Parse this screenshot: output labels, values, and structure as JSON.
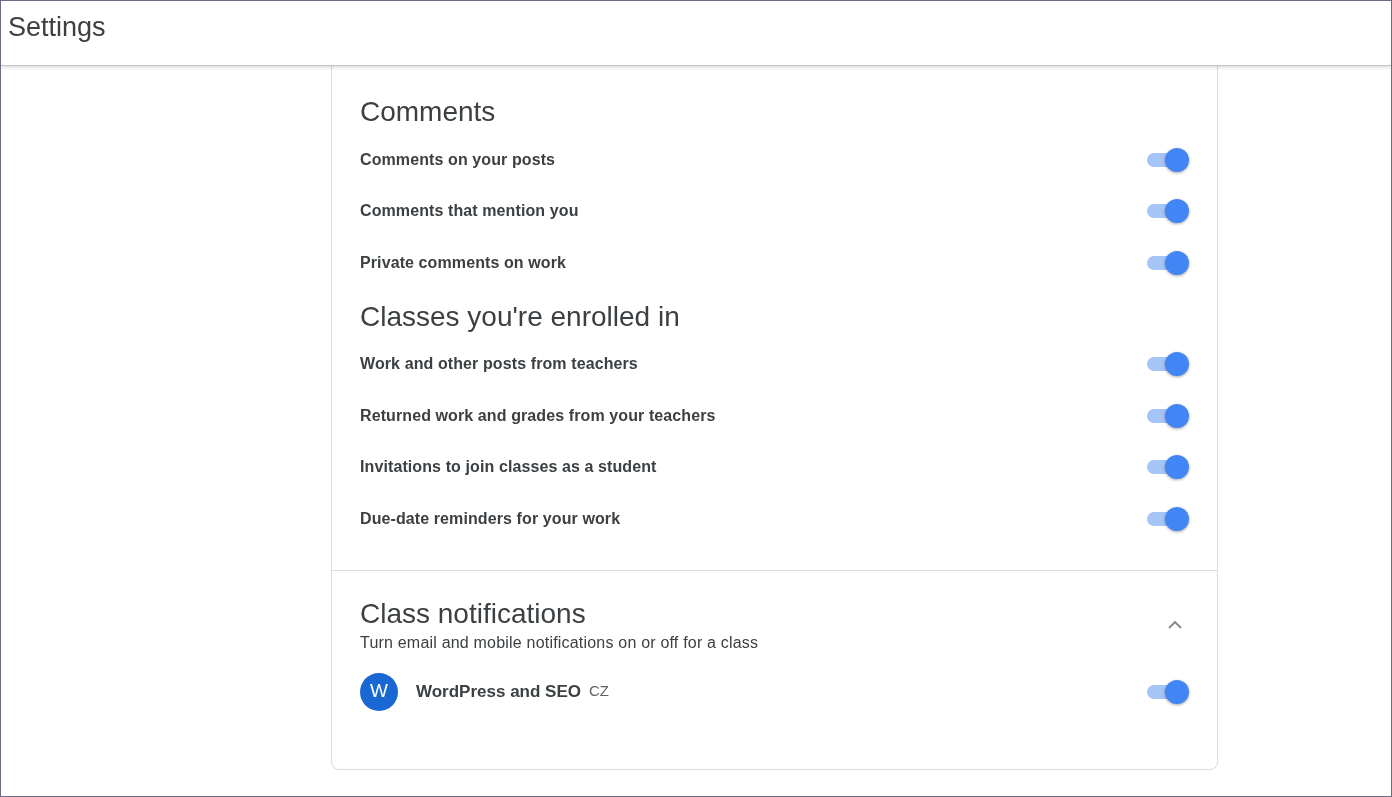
{
  "header": {
    "title": "Settings"
  },
  "sections": [
    {
      "title": "Comments",
      "items": [
        {
          "label": "Comments on your posts",
          "on": true
        },
        {
          "label": "Comments that mention you",
          "on": true
        },
        {
          "label": "Private comments on work",
          "on": true
        }
      ]
    },
    {
      "title": "Classes you're enrolled in",
      "items": [
        {
          "label": "Work and other posts from teachers",
          "on": true
        },
        {
          "label": "Returned work and grades from your teachers",
          "on": true
        },
        {
          "label": "Invitations to join classes as a student",
          "on": true
        },
        {
          "label": "Due-date reminders for your work",
          "on": true
        }
      ]
    }
  ],
  "class_notifications": {
    "title": "Class notifications",
    "subtitle": "Turn email and mobile notifications on or off for a class",
    "expanded": true,
    "classes": [
      {
        "initial": "W",
        "name": "WordPress and SEO",
        "section": "CZ",
        "on": true
      }
    ]
  }
}
